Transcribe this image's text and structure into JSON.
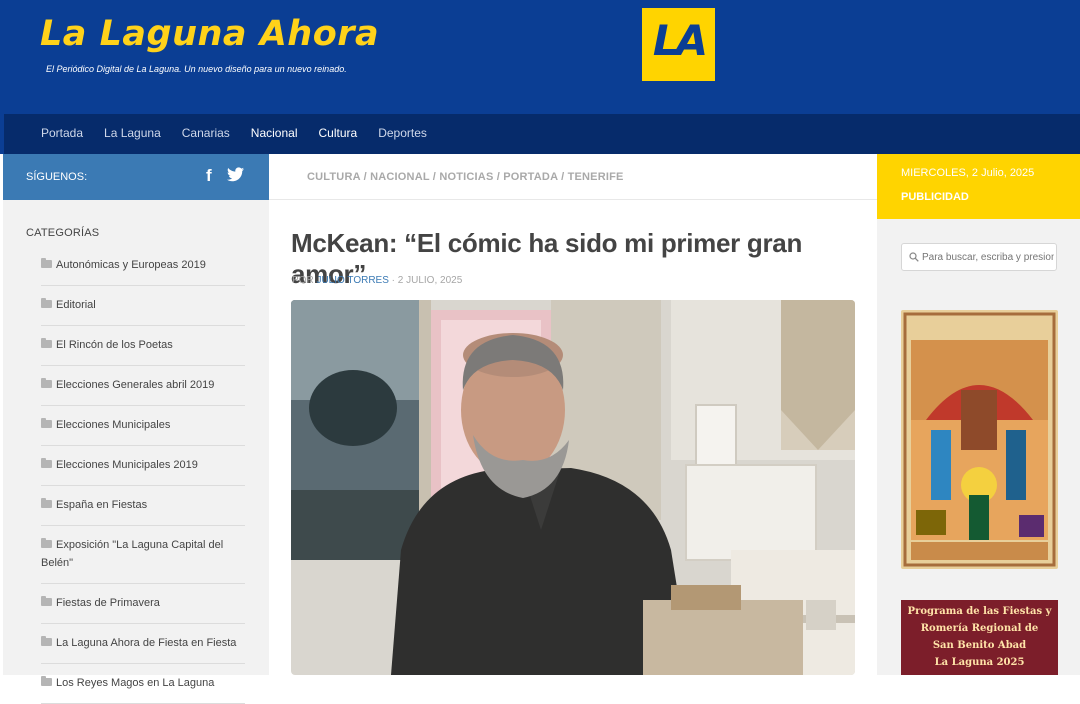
{
  "header": {
    "site_title": "La Laguna Ahora",
    "tagline": "El Periódico Digital de La Laguna. Un nuevo diseño para un nuevo reinado.",
    "logo_text": "LA",
    "colors": {
      "header_bg": "#0b3e94",
      "title": "#ffd21a",
      "logo_bg": "#ffd400"
    }
  },
  "nav": {
    "items": [
      "Portada",
      "La Laguna",
      "Canarias",
      "Nacional",
      "Cultura",
      "Deportes"
    ]
  },
  "left_sidebar": {
    "follow_label": "SÍGUENOS:",
    "social_icons": [
      "facebook-icon",
      "twitter-icon"
    ],
    "categories_heading": "CATEGORÍAS",
    "categories": [
      "Autonómicas y Europeas 2019",
      "Editorial",
      "El Rincón de los Poetas",
      "Elecciones Generales abril 2019",
      "Elecciones Municipales",
      "Elecciones Municipales 2019",
      "España en Fiestas",
      "Exposición \"La Laguna Capital del Belén\"",
      "Fiestas de Primavera",
      "La Laguna Ahora de Fiesta en Fiesta",
      "Los Reyes Magos en La Laguna"
    ]
  },
  "article": {
    "breadcrumbs": "CULTURA / NACIONAL / NOTICIAS / PORTADA / TENERIFE",
    "title": "McKean: “El cómic ha sido mi primer gran amor”",
    "by": "POR",
    "author": "JULIO TORRES",
    "date": "· 2 JULIO, 2025"
  },
  "right_sidebar": {
    "date": "MIERCOLES, 2 Julio, 2025",
    "ad_label": "PUBLICIDAD",
    "search_placeholder": "Para buscar, escriba y presione",
    "poster_caption_lines": [
      "Programa de las Fiestas y",
      "Romería Regional de",
      "San Benito Abad",
      "La Laguna 2025"
    ]
  }
}
